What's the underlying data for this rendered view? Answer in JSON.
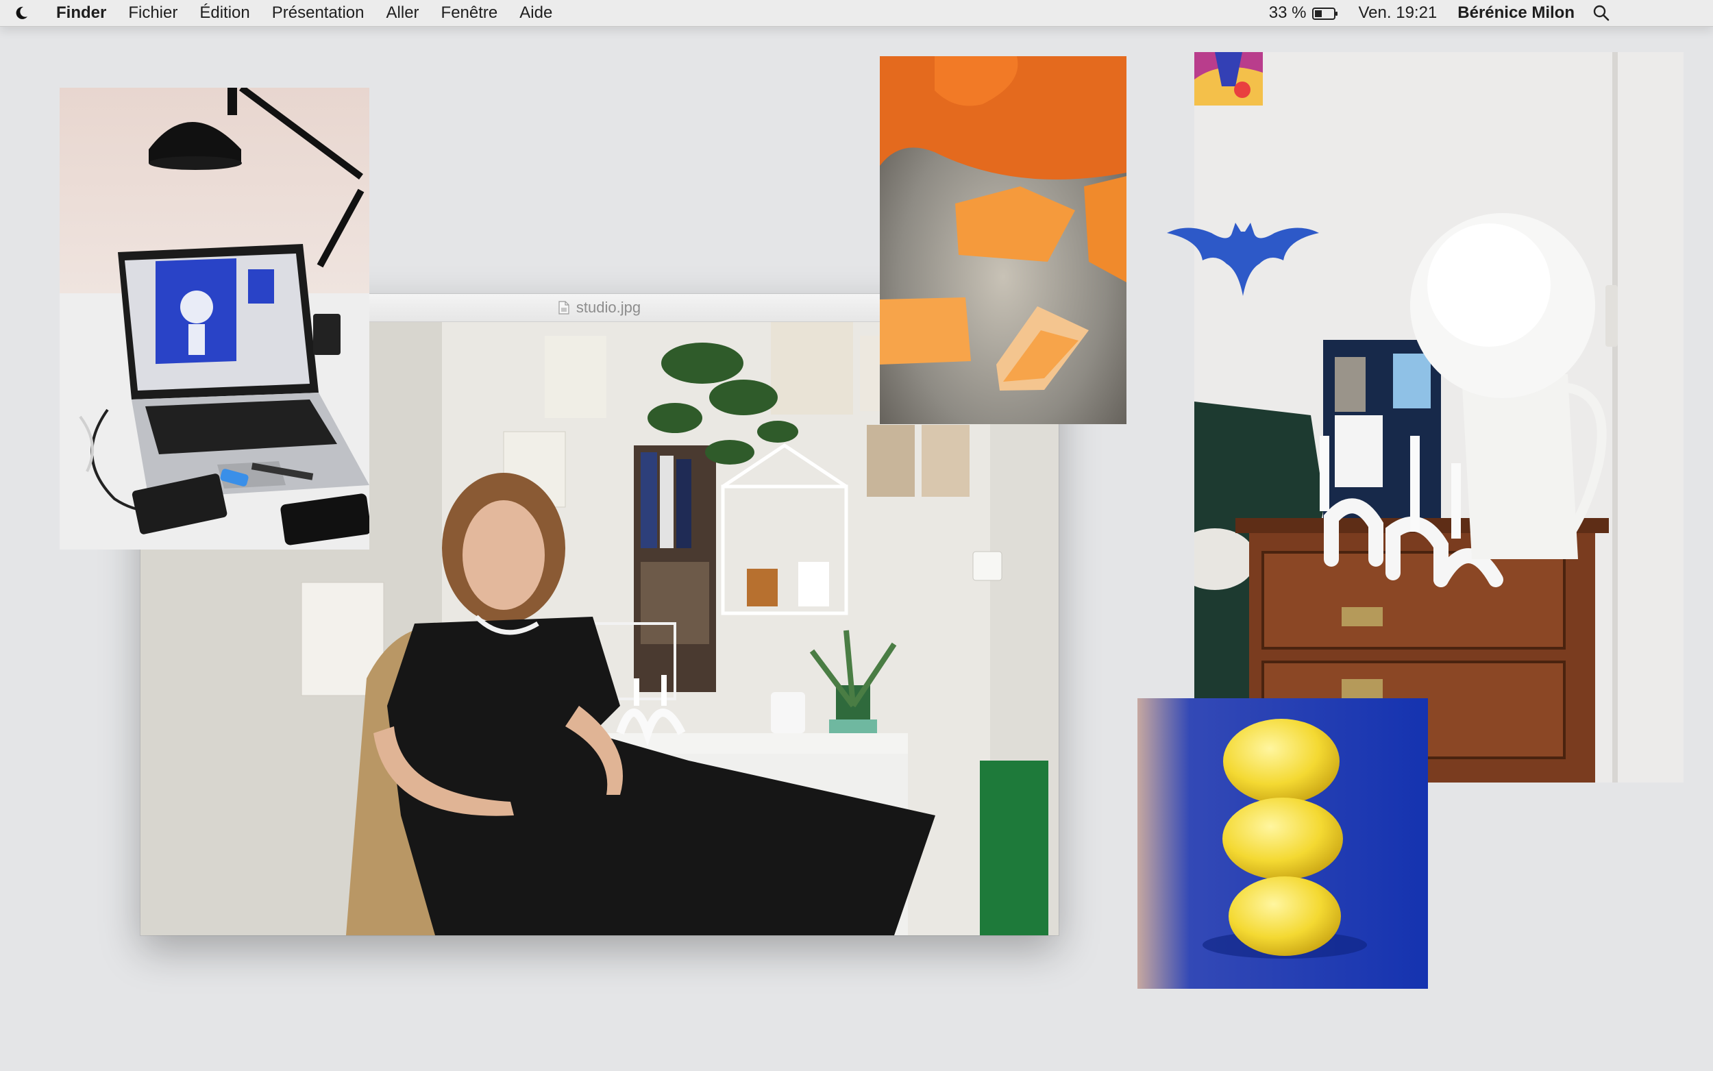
{
  "menubar": {
    "app_name": "Finder",
    "menus": [
      "Fichier",
      "Édition",
      "Présentation",
      "Aller",
      "Fenêtre",
      "Aide"
    ],
    "battery": "33 %",
    "clock": "Ven. 19:21",
    "user": "Bérénice Milon",
    "icons": [
      "moon-icon",
      "battery-icon",
      "search-icon"
    ]
  },
  "window": {
    "title": "studio.jpg",
    "icon": "image-file-icon"
  },
  "desktop_images": [
    "laptop-desk-photo",
    "squash-pieces-photo",
    "dresser-lamp-photo",
    "lemons-photo",
    "bat-shape",
    "abstract-art-thumbnail",
    "studio-portrait-photo"
  ],
  "colors": {
    "desktop_bg": "#e4e5e7",
    "bat_blue": "#2d59c8",
    "lemon_bg_blue": "#1f3fb5",
    "squash_orange": "#f59a3c"
  }
}
